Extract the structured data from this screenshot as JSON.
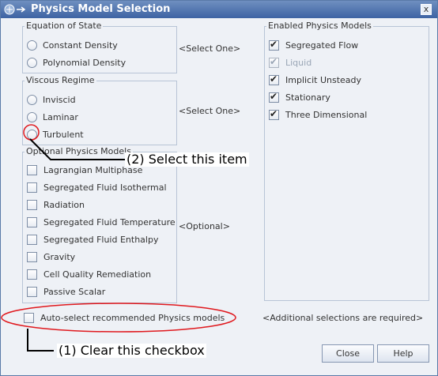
{
  "window": {
    "title": "Physics Model Selection",
    "close_label": "x"
  },
  "equation_of_state": {
    "title": "Equation of State",
    "options": [
      {
        "label": "Constant Density"
      },
      {
        "label": "Polynomial Density"
      }
    ],
    "hint": "<Select One>"
  },
  "viscous_regime": {
    "title": "Viscous Regime",
    "options": [
      {
        "label": "Inviscid"
      },
      {
        "label": "Laminar"
      },
      {
        "label": "Turbulent"
      }
    ],
    "hint": "<Select One>"
  },
  "optional_models": {
    "title": "Optional Physics Models",
    "items": [
      {
        "label": "Lagrangian Multiphase"
      },
      {
        "label": "Segregated Fluid Isothermal"
      },
      {
        "label": "Radiation"
      },
      {
        "label": "Segregated Fluid Temperature"
      },
      {
        "label": "Segregated Fluid Enthalpy"
      },
      {
        "label": "Gravity"
      },
      {
        "label": "Cell Quality Remediation"
      },
      {
        "label": "Passive Scalar"
      }
    ],
    "hint": "<Optional>"
  },
  "enabled_models": {
    "title": "Enabled Physics Models",
    "items": [
      {
        "label": "Segregated Flow",
        "checked": true,
        "disabled": false
      },
      {
        "label": "Liquid",
        "checked": true,
        "disabled": true
      },
      {
        "label": "Implicit Unsteady",
        "checked": true,
        "disabled": false
      },
      {
        "label": "Stationary",
        "checked": true,
        "disabled": false
      },
      {
        "label": "Three Dimensional",
        "checked": true,
        "disabled": false
      }
    ]
  },
  "auto_select": {
    "label": "Auto-select recommended Physics models",
    "checked": false
  },
  "additional_hint": "<Additional selections are required>",
  "buttons": {
    "close": "Close",
    "help": "Help"
  },
  "annotations": {
    "step1": "(1) Clear this checkbox",
    "step2": "(2) Select this item",
    "highlight_color": "#e0191e"
  }
}
